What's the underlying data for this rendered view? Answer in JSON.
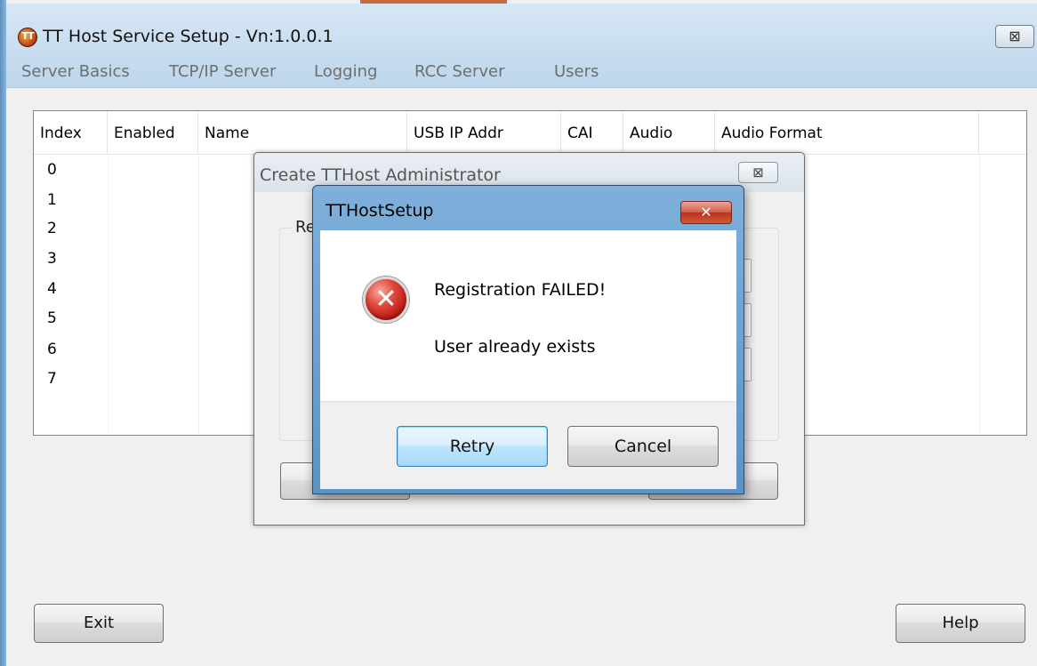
{
  "window": {
    "title": "TT Host Service Setup - Vn:1.0.0.1",
    "icon": "app-logo-icon",
    "icon_text": "TT",
    "close_glyph": "⊠"
  },
  "menu": {
    "items": [
      "Server Basics",
      "TCP/IP Server",
      "Logging",
      "RCC Server",
      "Users"
    ]
  },
  "table": {
    "columns": [
      "Index",
      "Enabled",
      "Name",
      "USB IP Addr",
      "CAI",
      "Audio",
      "Audio Format"
    ],
    "rows": [
      "0",
      "1",
      "2",
      "3",
      "4",
      "5",
      "6",
      "7"
    ]
  },
  "buttons": {
    "exit": "Exit",
    "help": "Help"
  },
  "admin_dialog": {
    "title": "Create TTHost Administrator",
    "close_glyph": "⊠",
    "group_label": "Re"
  },
  "error_dialog": {
    "title": "TTHostSetup",
    "close_glyph": "✕",
    "icon": "error-x-icon",
    "icon_glyph": "✕",
    "message": "Registration FAILED!",
    "detail": "User already exists",
    "retry_label": "Retry",
    "cancel_label": "Cancel"
  }
}
